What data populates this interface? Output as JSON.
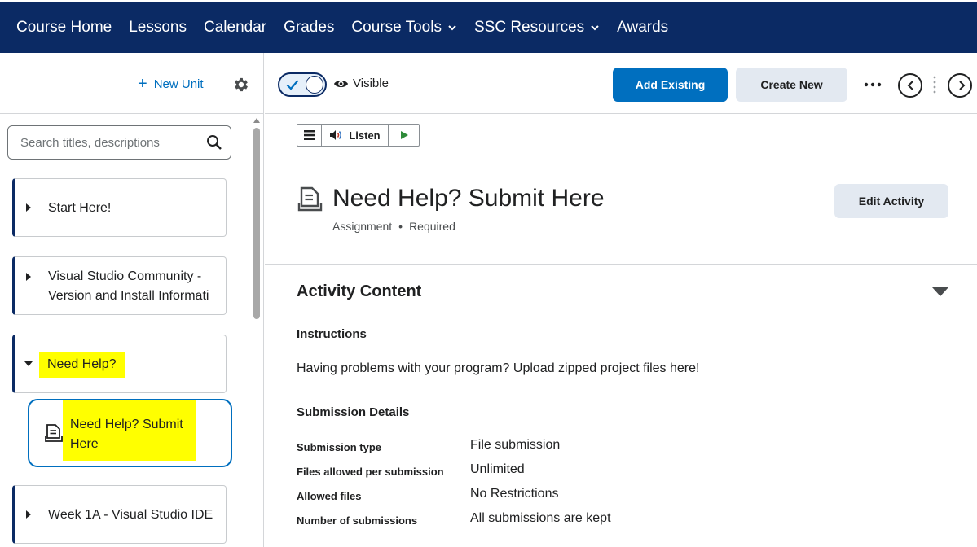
{
  "nav": {
    "items": [
      {
        "label": "Course Home",
        "has_menu": false
      },
      {
        "label": "Lessons",
        "has_menu": false
      },
      {
        "label": "Calendar",
        "has_menu": false
      },
      {
        "label": "Grades",
        "has_menu": false
      },
      {
        "label": "Course Tools",
        "has_menu": true
      },
      {
        "label": "SSC Resources",
        "has_menu": true
      },
      {
        "label": "Awards",
        "has_menu": false
      }
    ]
  },
  "sidebar": {
    "new_unit_label": "New Unit",
    "search_placeholder": "Search titles, descriptions",
    "units": [
      {
        "label": "Start Here!",
        "expanded": false
      },
      {
        "label": "Visual Studio Community - Version and Install Informati",
        "expanded": false
      },
      {
        "label": "Need Help?",
        "expanded": true
      },
      {
        "label": "Week 1A - Visual Studio IDE",
        "expanded": false
      }
    ],
    "child": {
      "label": "Need Help? Submit Here"
    }
  },
  "toolbar": {
    "visible_label": "Visible",
    "add_existing_label": "Add Existing",
    "create_new_label": "Create New"
  },
  "listen": {
    "label": "Listen"
  },
  "activity": {
    "title": "Need Help? Submit Here",
    "type": "Assignment",
    "requirement": "Required",
    "edit_label": "Edit Activity",
    "section_title": "Activity Content",
    "instructions_heading": "Instructions",
    "instructions_text": "Having problems with your program? Upload zipped project files here!",
    "submission_heading": "Submission Details",
    "details": [
      {
        "key": "Submission type",
        "value": "File submission"
      },
      {
        "key": "Files allowed per submission",
        "value": "Unlimited"
      },
      {
        "key": "Allowed files",
        "value": "No Restrictions"
      },
      {
        "key": "Number of submissions",
        "value": "All submissions are kept"
      }
    ]
  },
  "colors": {
    "nav_bg": "#0b2a64",
    "primary": "#006fbf",
    "highlight": "#ffff00"
  }
}
